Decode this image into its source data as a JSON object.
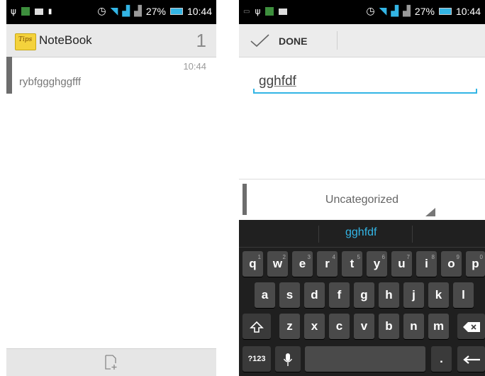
{
  "left": {
    "status": {
      "battery": "27%",
      "time": "10:44"
    },
    "app_title": "NoteBook",
    "logo_text": "Tips",
    "note_count": "1",
    "notes": [
      {
        "time": "10:44",
        "text": "rybfggghggfff"
      }
    ]
  },
  "right": {
    "status": {
      "battery": "27%",
      "time": "10:44"
    },
    "done_label": "DONE",
    "title_value": "gghfdf",
    "category": "Uncategorized",
    "keyboard": {
      "suggestion": "gghfdf",
      "row1": [
        "q",
        "w",
        "e",
        "r",
        "t",
        "y",
        "u",
        "i",
        "o",
        "p"
      ],
      "row1_nums": [
        "1",
        "2",
        "3",
        "4",
        "5",
        "6",
        "7",
        "8",
        "9",
        "0"
      ],
      "row2": [
        "a",
        "s",
        "d",
        "f",
        "g",
        "h",
        "j",
        "k",
        "l"
      ],
      "row3": [
        "z",
        "x",
        "c",
        "v",
        "b",
        "n",
        "m"
      ],
      "symbols_key": "?123",
      "period_key": "."
    }
  },
  "colors": {
    "accent": "#33b5e5",
    "statusbar": "#000000",
    "keyboard": "#1f1f1f"
  }
}
